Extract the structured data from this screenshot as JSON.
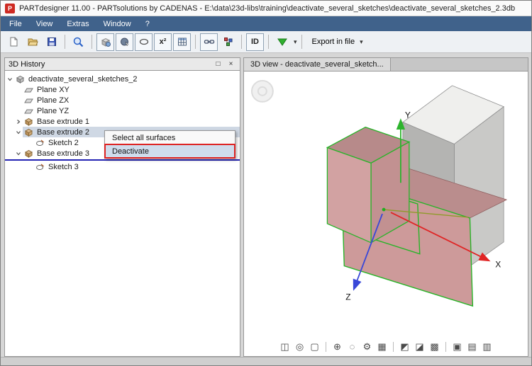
{
  "window": {
    "icon_text": "P",
    "title": "PARTdesigner 11.00 - PARTsolutions by CADENAS - E:\\data\\23d-libs\\training\\deactivate_several_sketches\\deactivate_several_sketches_2.3db"
  },
  "menubar": {
    "items": [
      "File",
      "View",
      "Extras",
      "Window",
      "?"
    ]
  },
  "toolbar": {
    "x2_label": "x²",
    "id_label": "ID",
    "export_label": "Export in file",
    "caret": "▾"
  },
  "history_panel": {
    "title": "3D History",
    "maximize_glyph": "□",
    "close_glyph": "×",
    "tree": [
      {
        "label": "deactivate_several_sketches_2"
      },
      {
        "label": "Plane XY"
      },
      {
        "label": "Plane ZX"
      },
      {
        "label": "Plane YZ"
      },
      {
        "label": "Base extrude 1"
      },
      {
        "label": "Base extrude 2"
      },
      {
        "label": "Sketch 2"
      },
      {
        "label": "Base extrude 3"
      },
      {
        "label": "Sketch 3"
      }
    ]
  },
  "context_menu": {
    "items": [
      {
        "label": "Select all surfaces"
      },
      {
        "label": "Deactivate"
      }
    ]
  },
  "view_panel": {
    "tab_label": "3D view - deactivate_several_sketch...",
    "axes": {
      "x": "X",
      "y": "Y",
      "z": "Z"
    }
  },
  "viewport_toolbar": {
    "icons": [
      {
        "name": "fit-view-icon",
        "glyph": "◫"
      },
      {
        "name": "sphere-view-icon",
        "glyph": "◎"
      },
      {
        "name": "box-view-icon",
        "glyph": "▢"
      },
      {
        "name": "zoom-icon",
        "glyph": "⊕"
      },
      {
        "name": "orbit-icon",
        "glyph": "◌"
      },
      {
        "name": "settings-gear-icon",
        "glyph": "⚙"
      },
      {
        "name": "grid-icon",
        "glyph": "▦"
      },
      {
        "name": "shaded-mode-icon",
        "glyph": "◩"
      },
      {
        "name": "wireframe-mode-icon",
        "glyph": "◪"
      },
      {
        "name": "hiddenline-mode-icon",
        "glyph": "▩"
      },
      {
        "name": "iso-view-icon",
        "glyph": "▣"
      },
      {
        "name": "front-view-icon",
        "glyph": "▤"
      },
      {
        "name": "side-view-icon",
        "glyph": "▥"
      }
    ]
  },
  "colors": {
    "menubar": "#40628b",
    "selection": "#cfd8e4",
    "insert_line": "#2424b4",
    "annotation_red": "#dd2222",
    "axis_x": "#e02525",
    "axis_y": "#2db42d",
    "axis_z": "#3948d8",
    "solid_pink": "#cd9a9a",
    "solid_gray": "#b4b4b2",
    "edge_green": "#28b428"
  }
}
